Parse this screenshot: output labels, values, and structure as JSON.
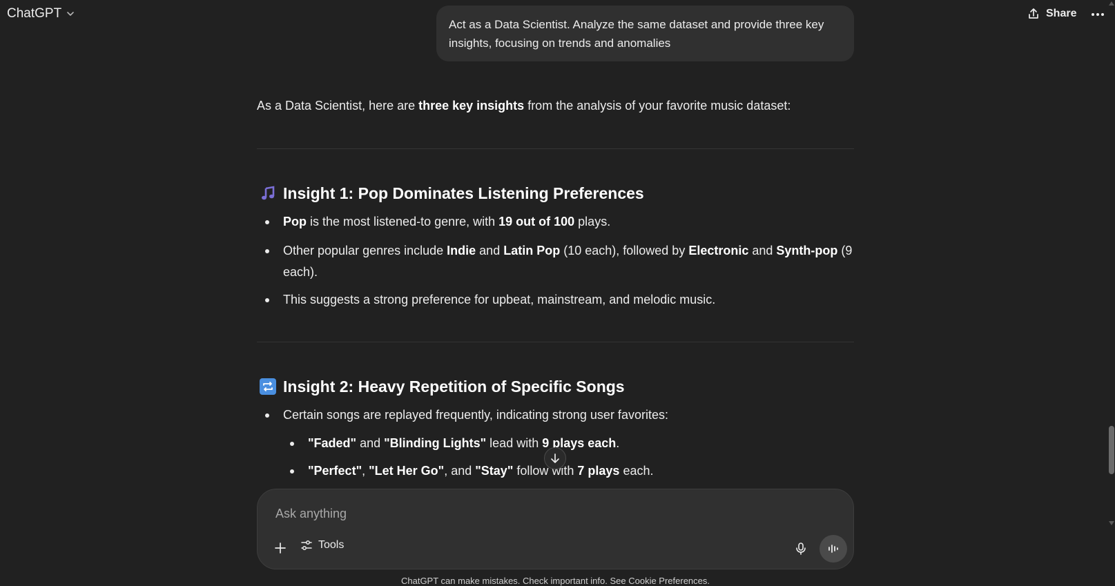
{
  "header": {
    "model_label": "ChatGPT",
    "share_label": "Share"
  },
  "user_message": "Act as a Data Scientist. Analyze the same dataset and provide three key insights, focusing on trends and anomalies",
  "response": {
    "intro": {
      "pre": "As a Data Scientist, here are ",
      "bold": "three key insights",
      "post": " from the analysis of your favorite music dataset:"
    },
    "insight1": {
      "emoji": "music-note-icon",
      "title": "Insight 1: Pop Dominates Listening Preferences",
      "b1": {
        "t1": "Pop",
        "t2": " is the most listened-to genre, with ",
        "t3": "19 out of 100",
        "t4": " plays."
      },
      "b2": {
        "t1": "Other popular genres include ",
        "t2": "Indie",
        "t3": " and ",
        "t4": "Latin Pop",
        "t5": " (10 each), followed by ",
        "t6": "Electronic",
        "t7": " and ",
        "t8": "Synth-pop",
        "t9": " (9",
        "t10": "each)."
      },
      "b3": "This suggests a strong preference for upbeat, mainstream, and melodic music."
    },
    "insight2": {
      "emoji": "repeat-icon",
      "title": "Insight 2: Heavy Repetition of Specific Songs",
      "b1": "Certain songs are replayed frequently, indicating strong user favorites:",
      "s1": {
        "t1": "\"Faded\"",
        "t2": " and ",
        "t3": "\"Blinding Lights\"",
        "t4": " lead with ",
        "t5": "9 plays each",
        "t6": "."
      },
      "s2": {
        "t1": "\"Perfect\"",
        "t2": ", ",
        "t3": "\"Let Her Go\"",
        "t4": ", and ",
        "t5": "\"Stay\"",
        "t6": " follow with ",
        "t7": "7 plays",
        "t8": " each."
      }
    }
  },
  "composer": {
    "placeholder": "Ask anything",
    "tools_label": "Tools"
  },
  "disclaimer": "ChatGPT can make mistakes. Check important info. See Cookie Preferences.",
  "colors": {
    "background": "#212121",
    "bubble": "#303030",
    "text": "#ececec",
    "music_icon": "#7b6fd6",
    "repeat_icon": "#4a8fe0"
  }
}
